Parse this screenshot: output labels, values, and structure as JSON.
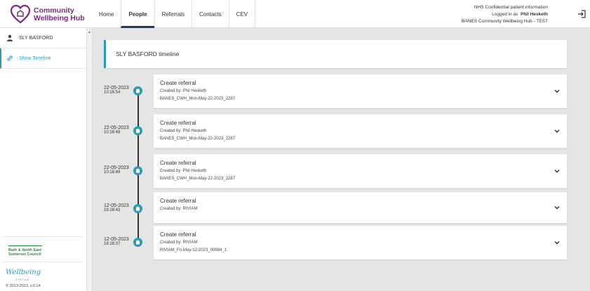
{
  "header": {
    "logo_line1": "Community",
    "logo_line2": "Wellbeing Hub",
    "nav": [
      "Home",
      "People",
      "Referrals",
      "Contacts",
      "CEV"
    ],
    "active_nav": "People",
    "info_line1": "NHS Confidential patient information",
    "logged_in_label": "Logged in as",
    "user_name": "Phil Hesketh",
    "org_line": "BANES Community Wellbeing Hub - TEST"
  },
  "sidebar": {
    "person_name": "SLY BASFORD",
    "show_timeline": "Show Timeline",
    "council_line1": "Bath & North East",
    "council_line2": "Somerset Council",
    "wellbeing_logo": "Wellbeing",
    "wellbeing_sub": "VIRTUE",
    "copyright": "© 2013-2023, v.0.14"
  },
  "main": {
    "title": "SLY BASFORD timeline",
    "events": [
      {
        "date": "22-05-2023",
        "time": "10:16:54",
        "title": "Create referral",
        "created_by": "Created by: Phil Hesketh",
        "ref": "BANES_CWH_Mon-May-22-2023_2287"
      },
      {
        "date": "22-05-2023",
        "time": "10:16:49",
        "title": "Create referral",
        "created_by": "Created by: Phil Hesketh",
        "ref": "BANES_CWH_Mon-May-22-2023_2287"
      },
      {
        "date": "22-05-2023",
        "time": "10:16:49",
        "title": "Create referral",
        "created_by": "Created by: Phil Hesketh",
        "ref": "BANES_CWH_Mon-May-22-2023_2287"
      },
      {
        "date": "12-05-2023",
        "time": "16:28:43",
        "title": "Create referral",
        "created_by": "Created by: RIVIAM",
        "ref": ""
      },
      {
        "date": "12-05-2023",
        "time": "16:28:37",
        "title": "Create referral",
        "created_by": "Created by: RIVIAM",
        "ref": "RIVIAM_Fri-May-12-2023_00684_1"
      }
    ]
  },
  "colors": {
    "accent": "#2c9bb8",
    "brand": "#7a2a82",
    "nav_active": "#1f3b5a"
  }
}
